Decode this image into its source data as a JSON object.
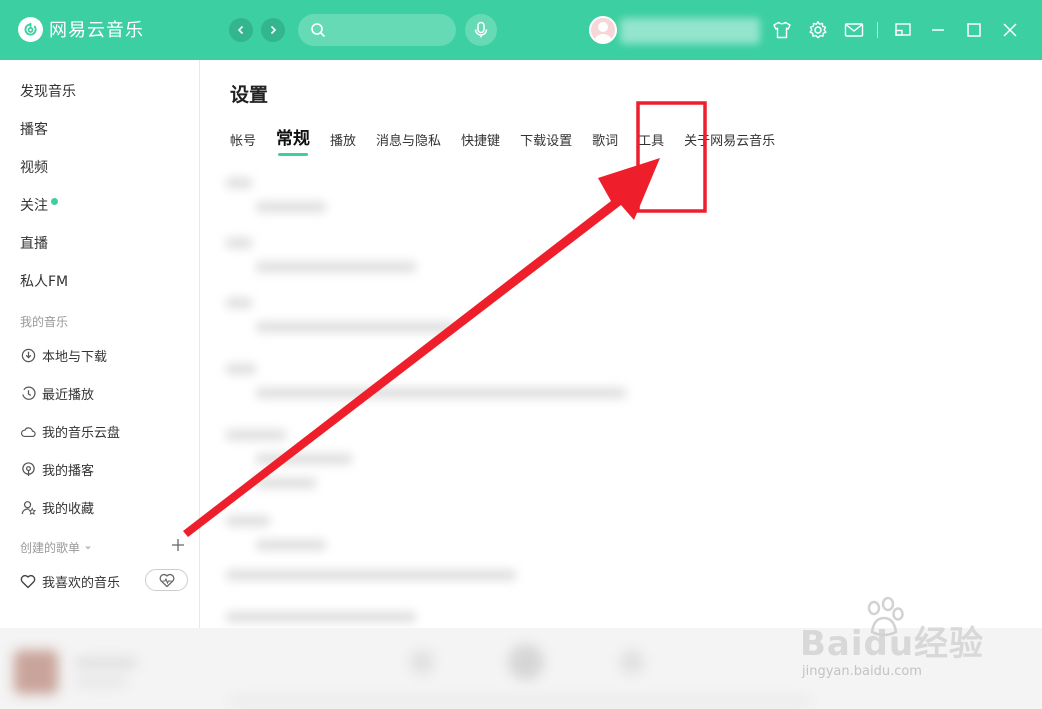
{
  "app": {
    "title": "网易云音乐"
  },
  "colors": {
    "brand": "#3bcfa1",
    "annotation": "#ee1f2b"
  },
  "sidebar": {
    "items": [
      {
        "label": "发现音乐"
      },
      {
        "label": "播客"
      },
      {
        "label": "视频"
      },
      {
        "label": "关注"
      },
      {
        "label": "直播"
      },
      {
        "label": "私人FM"
      }
    ],
    "my_music_title": "我的音乐",
    "my_music": [
      {
        "label": "本地与下载",
        "icon": "download-icon"
      },
      {
        "label": "最近播放",
        "icon": "recent-icon"
      },
      {
        "label": "我的音乐云盘",
        "icon": "cloud-icon"
      },
      {
        "label": "我的播客",
        "icon": "podcast-icon"
      },
      {
        "label": "我的收藏",
        "icon": "favorite-icon"
      }
    ],
    "created_playlists_title": "创建的歌单",
    "liked_music": "我喜欢的音乐"
  },
  "settings": {
    "title": "设置",
    "tabs": [
      {
        "label": "帐号"
      },
      {
        "label": "常规"
      },
      {
        "label": "播放"
      },
      {
        "label": "消息与隐私"
      },
      {
        "label": "快捷键"
      },
      {
        "label": "下载设置"
      },
      {
        "label": "歌词"
      },
      {
        "label": "工具"
      },
      {
        "label": "关于网易云音乐"
      }
    ],
    "active_tab": "常规",
    "highlighted_tab": "工具"
  },
  "watermark": {
    "brand": "Baidu经验",
    "url": "jingyan.baidu.com"
  }
}
